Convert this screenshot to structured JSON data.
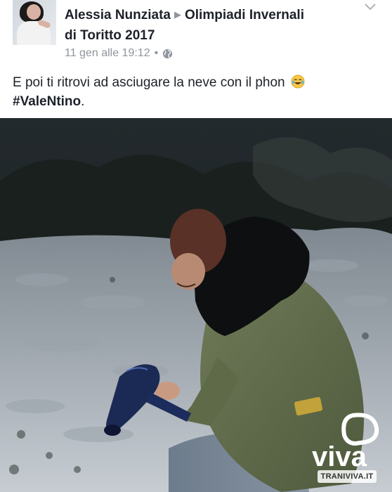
{
  "post": {
    "author": "Alessia Nunziata",
    "group_line1": "Olimpiadi Invernali",
    "group_line2": "di Toritto 2017",
    "timestamp": "11 gen alle 19:12",
    "separator": "•",
    "privacy_icon": "globe-icon",
    "text": "E poi ti ritrovi ad asciugare la neve con il phon",
    "emoji": "laughing-tears-emoji",
    "hashtag": "#ValeNtino",
    "hashtag_suffix": "."
  },
  "photo": {
    "watermark_logo": "viva",
    "watermark_site": "TRANIVIVA.IT"
  },
  "colors": {
    "name": "#1d2129",
    "meta": "#90949c",
    "photo_dark": "#1e2326"
  }
}
